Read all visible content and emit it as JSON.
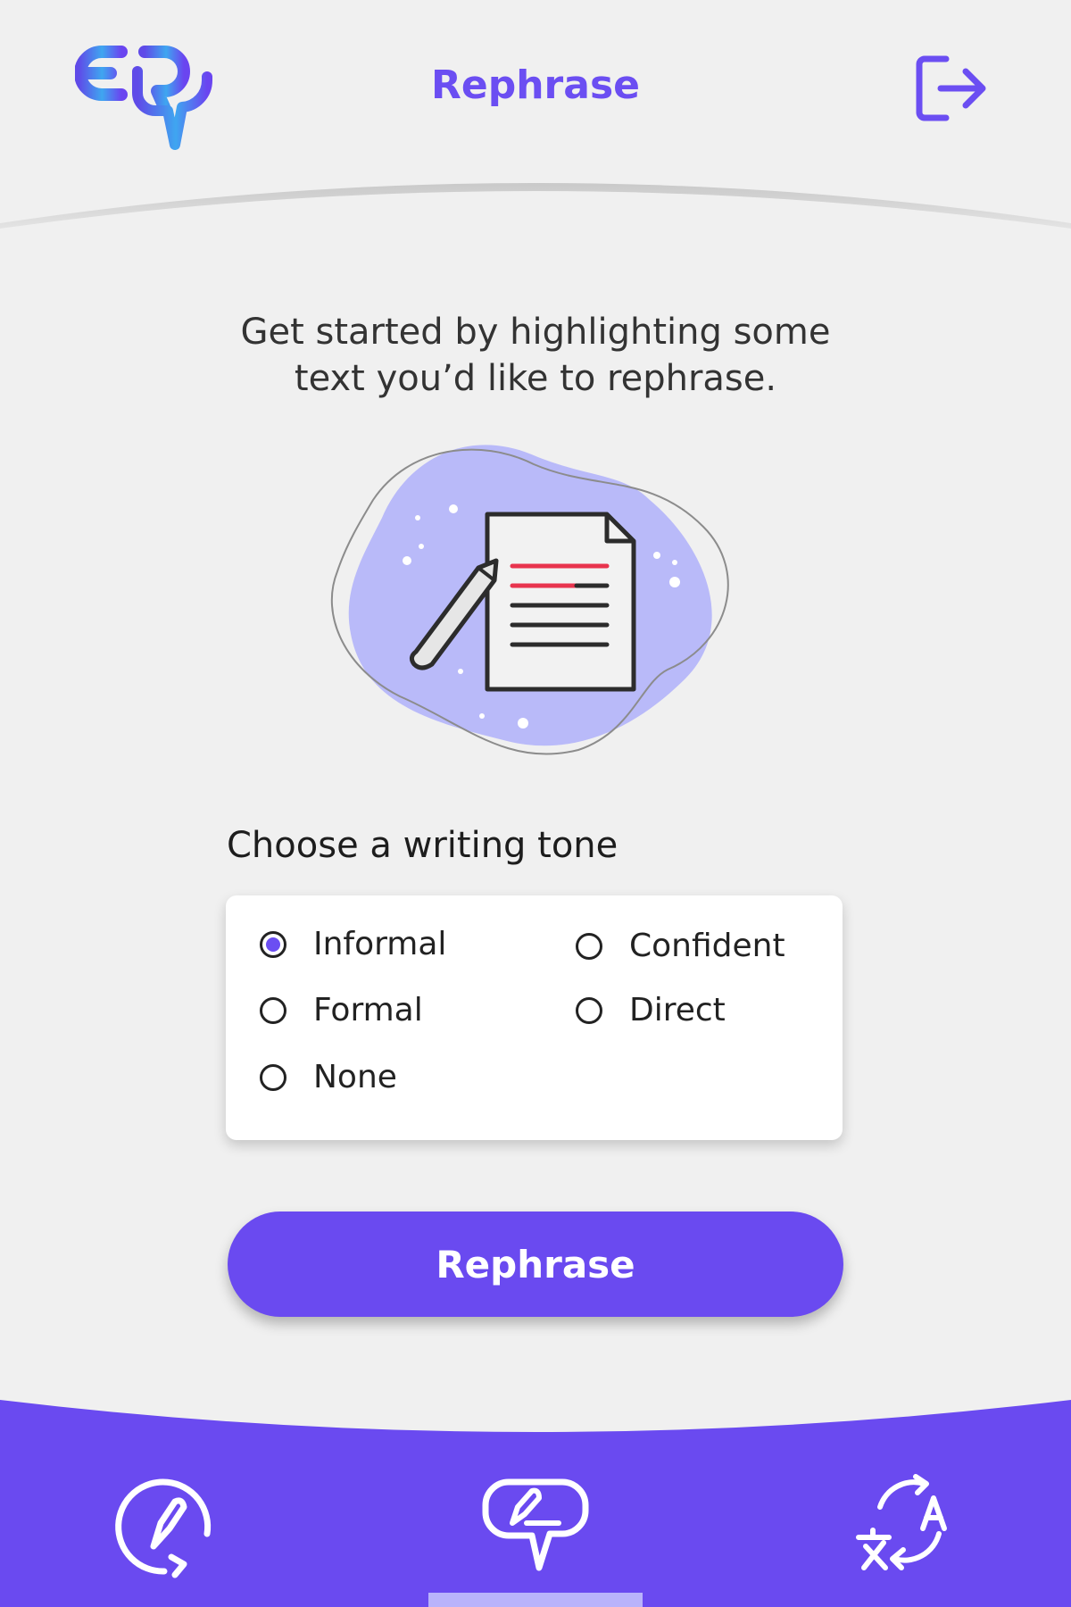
{
  "header": {
    "title": "Rephrase",
    "logo_icon": "ep-chat-logo-icon",
    "logout_icon": "logout-icon"
  },
  "intro": {
    "line1": "Get started by highlighting some",
    "line2": "text you’d like to rephrase."
  },
  "illustration": {
    "icon": "document-pencil-illustration"
  },
  "tone": {
    "heading": "Choose a writing tone",
    "selected": "Informal",
    "options": [
      {
        "label": "Informal",
        "checked": true
      },
      {
        "label": "Confident",
        "checked": false
      },
      {
        "label": "Formal",
        "checked": false
      },
      {
        "label": "Direct",
        "checked": false
      },
      {
        "label": "None",
        "checked": false
      }
    ]
  },
  "action": {
    "button_label": "Rephrase"
  },
  "nav": {
    "items": [
      {
        "icon": "edit-refresh-icon"
      },
      {
        "icon": "chat-pen-icon",
        "active": true
      },
      {
        "icon": "translate-icon"
      }
    ]
  },
  "colors": {
    "accent": "#6a4af0",
    "background": "#f0f0f0",
    "highlight_line": "#e8344e",
    "blob": "#b9baf9"
  }
}
